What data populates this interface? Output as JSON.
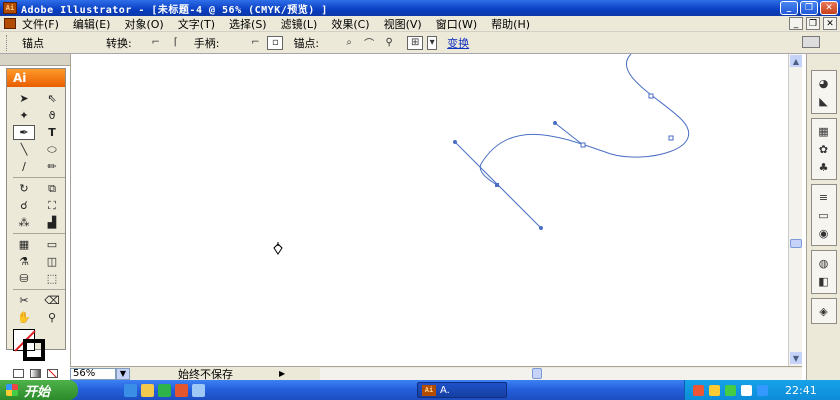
{
  "window": {
    "title": "Adobe Illustrator - [未标题-4 @ 56% (CMYK/预览) ]",
    "app_icon": "Ai",
    "min_label": "_",
    "max_label": "❐",
    "close_label": "✕"
  },
  "menu": {
    "items": [
      "文件(F)",
      "编辑(E)",
      "对象(O)",
      "文字(T)",
      "选择(S)",
      "滤镜(L)",
      "效果(C)",
      "视图(V)",
      "窗口(W)",
      "帮助(H)"
    ]
  },
  "control_bar": {
    "anchor_label": "锚点",
    "convert_label": "转换:",
    "handles_label": "手柄:",
    "anchors_label": "锚点:",
    "isolate_link": "变换"
  },
  "tools_panel": {
    "logo": "Ai"
  },
  "status_bar": {
    "zoom": "56%",
    "status_text": "始终不保存"
  },
  "taskbar": {
    "start_label": "开始",
    "task_label": "A.",
    "clock": "22:41"
  },
  "colors": {
    "title_bar": "#0a3fc2",
    "chrome": "#ece9d8",
    "path_stroke": "#4a6fc4",
    "ai_orange": "#e85d00",
    "taskbar": "#245edb",
    "start_green": "#2c8a2a"
  }
}
